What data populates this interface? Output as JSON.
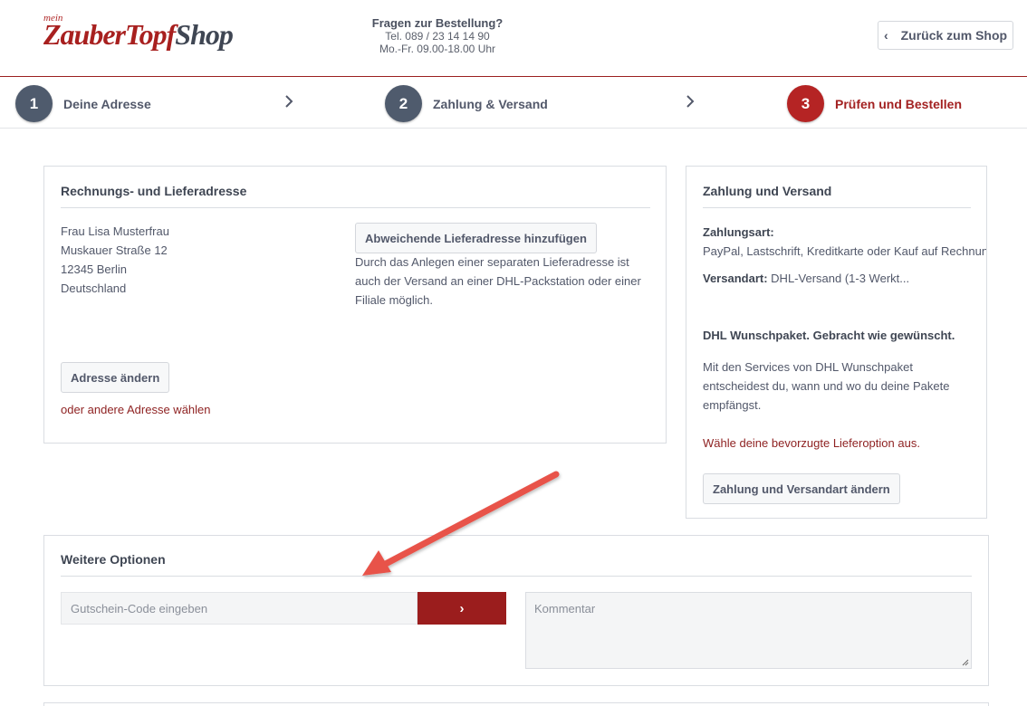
{
  "header": {
    "logo_small": "mein",
    "logo_part1": "ZauberTopf",
    "logo_part2": "Shop",
    "contact_question": "Fragen zur Bestellung?",
    "contact_phone": "Tel. 089 / 23 14 14 90",
    "contact_hours": "Mo.-Fr. 09.00-18.00 Uhr",
    "back_label": "Zurück zum Shop"
  },
  "steps": [
    {
      "number": "1",
      "label": "Deine Adresse"
    },
    {
      "number": "2",
      "label": "Zahlung & Versand"
    },
    {
      "number": "3",
      "label": "Prüfen und Bestellen"
    }
  ],
  "address": {
    "title": "Rechnungs- und Lieferadresse",
    "lines": [
      "Frau Lisa Musterfrau",
      "Muskauer Straße 12",
      "12345 Berlin",
      "Deutschland"
    ],
    "alt_button": "Abweichende Lieferadresse hinzufügen",
    "alt_text": "Durch das Anlegen einer separaten Lieferadresse ist auch der Versand an einer DHL-Packstation oder einer Filiale möglich.",
    "change_button": "Adresse ändern",
    "other_link": "oder andere Adresse wählen"
  },
  "payment": {
    "title": "Zahlung und Versand",
    "method_label": "Zahlungsart:",
    "method_value": "PayPal, Lastschrift, Kreditkarte oder Kauf auf Rechnung",
    "shipping_label": "Versandart:",
    "shipping_value": "DHL-Versand (1-3 Werkt...",
    "dhl_title": "DHL Wunschpaket. Gebracht wie gewünscht.",
    "dhl_text": "Mit den Services von DHL Wunschpaket entscheidest du, wann und wo du deine Pakete empfängst.",
    "dhl_link": "Wähle deine bevorzugte Lieferoption aus.",
    "change_button": "Zahlung und Versandart ändern"
  },
  "options": {
    "title": "Weitere Optionen",
    "voucher_placeholder": "Gutschein-Code eingeben",
    "comment_placeholder": "Kommentar"
  },
  "colors": {
    "brand_red": "#9b1d1d",
    "step_dark": "#4f5b6d",
    "arrow": "#e8534a"
  }
}
